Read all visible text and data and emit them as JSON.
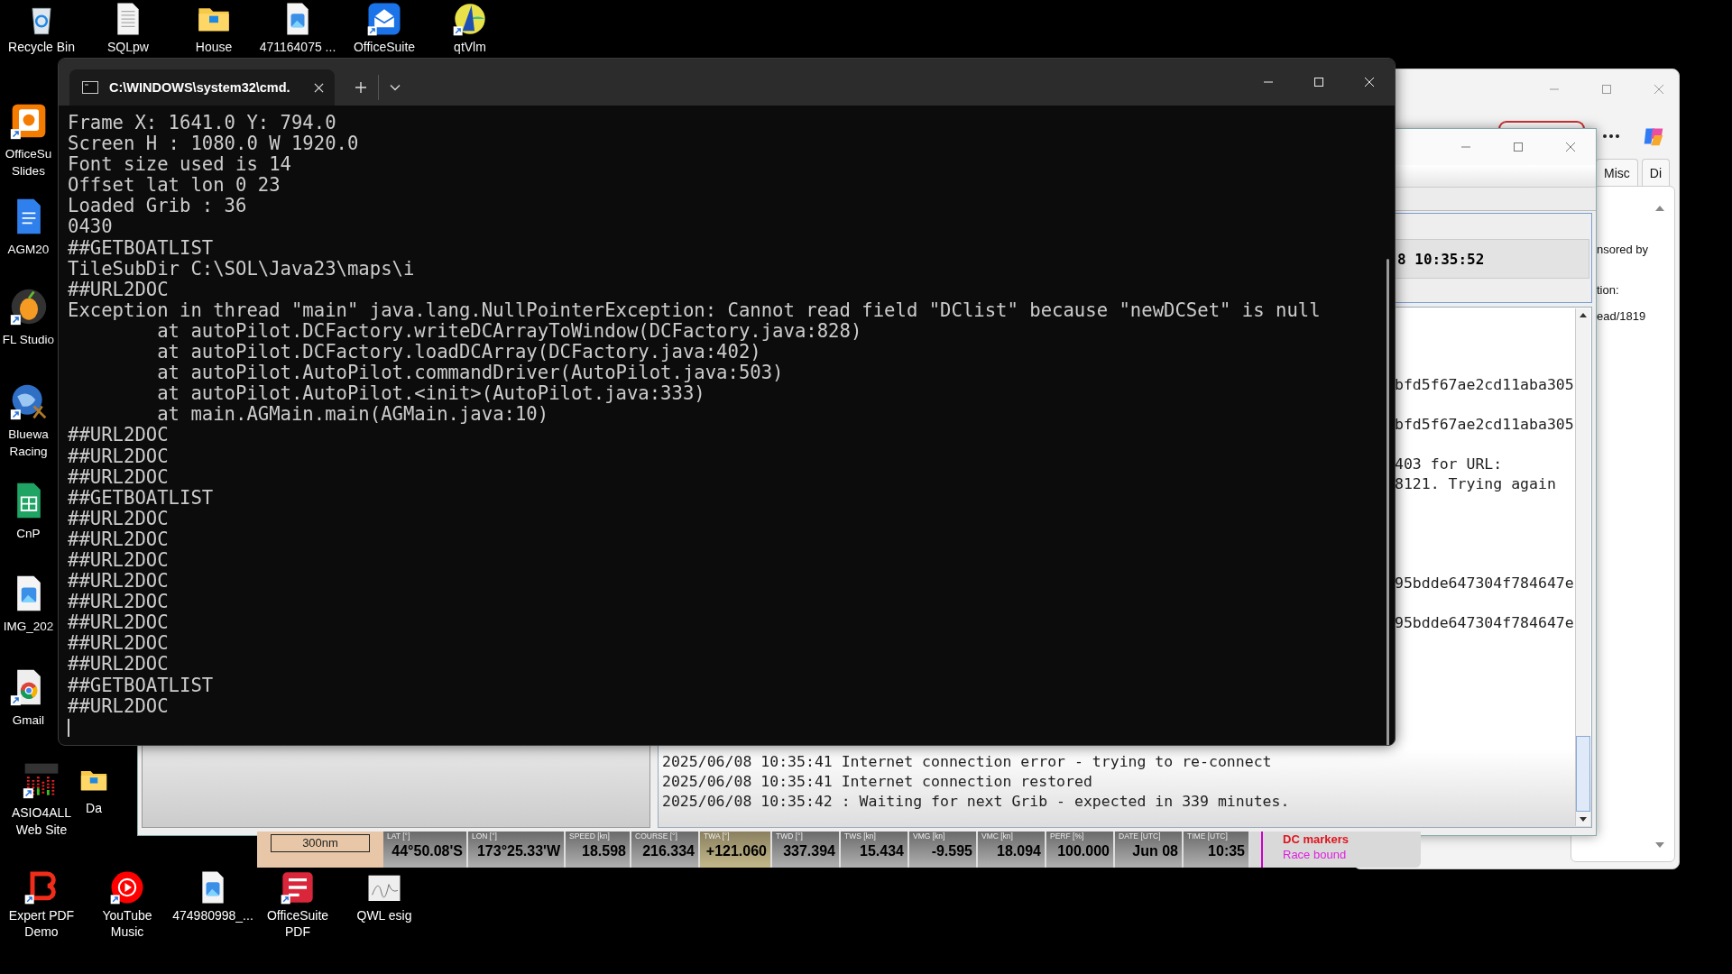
{
  "desktop_icons": [
    {
      "lines": [
        "Recycle Bin"
      ],
      "kind": "recycle",
      "shortcut": false
    },
    {
      "lines": [
        "SQLpw"
      ],
      "kind": "document",
      "shortcut": false
    },
    {
      "lines": [
        "House"
      ],
      "kind": "folder",
      "shortcut": false
    },
    {
      "lines": [
        "471164075 ..."
      ],
      "kind": "image",
      "shortcut": false
    },
    {
      "lines": [
        "OfficeSuite"
      ],
      "kind": "mail",
      "shortcut": true
    },
    {
      "lines": [
        "qtVlm"
      ],
      "kind": "sail",
      "shortcut": true
    },
    {
      "lines": [
        "OfficeSu",
        "Slides"
      ],
      "kind": "slides",
      "shortcut": true
    },
    {
      "lines": [
        "AGM20"
      ],
      "kind": "doc",
      "shortcut": false
    },
    {
      "lines": [
        "FL Studio"
      ],
      "kind": "fruit",
      "shortcut": true
    },
    {
      "lines": [
        "Bluewa",
        "Racing"
      ],
      "kind": "globe",
      "shortcut": true
    },
    {
      "lines": [
        "CnP"
      ],
      "kind": "sheet",
      "shortcut": false
    },
    {
      "lines": [
        "IMG_202"
      ],
      "kind": "image",
      "shortcut": false
    },
    {
      "lines": [
        "Gmail"
      ],
      "kind": "browser",
      "shortcut": true
    },
    {
      "lines": [
        "ASIO4ALL",
        "Web Site"
      ],
      "kind": "meter",
      "shortcut": true
    },
    {
      "lines": [
        "Da"
      ],
      "kind": "folder",
      "shortcut": false
    },
    {
      "lines": [
        "Expert PDF",
        "Demo"
      ],
      "kind": "pdf",
      "shortcut": true
    },
    {
      "lines": [
        "YouTube",
        "Music"
      ],
      "kind": "play",
      "shortcut": true
    },
    {
      "lines": [
        "474980998_..."
      ],
      "kind": "image",
      "shortcut": false
    },
    {
      "lines": [
        "OfficeSuite",
        "PDF"
      ],
      "kind": "pdfred",
      "shortcut": true
    },
    {
      "lines": [
        "QWL esig"
      ],
      "kind": "signature",
      "shortcut": false
    }
  ],
  "browser": {
    "tabs": [
      {
        "label": "Misc",
        "selected": false
      },
      {
        "label": "Di",
        "selected": false
      }
    ],
    "texts": [
      "nsored by",
      "tion:",
      "ead/1819"
    ]
  },
  "app": {
    "clock": "8 10:35:52",
    "log_fragments": [
      "bfd5f67ae2cd11aba305",
      "bfd5f67ae2cd11aba305",
      "403 for URL:",
      "8121. Trying again",
      "95bdde647304f784647e",
      "95bdde647304f784647e"
    ],
    "log_lines": [
      "2025/06/08 10:35:41 Internet connection error - trying to re-connect",
      "2025/06/08 10:35:41 Internet connection restored",
      "2025/06/08 10:35:42 : Waiting for next Grib - expected in 339 minutes."
    ]
  },
  "status_bar": {
    "range": "300nm",
    "cells": [
      {
        "label": "LAT [°]",
        "value": "44°50.08'S",
        "highlighted": false
      },
      {
        "label": "LON [°]",
        "value": "173°25.33'W",
        "highlighted": false
      },
      {
        "label": "SPEED [kn]",
        "value": "18.598",
        "highlighted": false
      },
      {
        "label": "COURSE [°]",
        "value": "216.334",
        "highlighted": false
      },
      {
        "label": "TWA [°]",
        "value": "+121.060",
        "highlighted": true
      },
      {
        "label": "TWD [°]",
        "value": "337.394",
        "highlighted": false
      },
      {
        "label": "TWS [kn]",
        "value": "15.434",
        "highlighted": false
      },
      {
        "label": "VMG [kn]",
        "value": "-9.595",
        "highlighted": false
      },
      {
        "label": "VMC [kn]",
        "value": "18.094",
        "highlighted": false
      },
      {
        "label": "PERF [%]",
        "value": "100.000",
        "highlighted": false
      },
      {
        "label": "DATE [UTC]",
        "value": "Jun 08",
        "highlighted": false
      },
      {
        "label": "TIME [UTC]",
        "value": "10:35",
        "highlighted": false
      }
    ],
    "markers": "DC markers",
    "boundary": "Race bound"
  },
  "console": {
    "tab": {
      "title": "C:\\WINDOWS\\system32\\cmd.",
      "selected": true
    },
    "lines": [
      "Frame X: 1641.0 Y: 794.0",
      "Screen H : 1080.0 W 1920.0",
      "Font size used is 14",
      "Offset lat lon 0 23",
      "Loaded Grib : 36",
      "0430",
      "##GETBOATLIST",
      "TileSubDir C:\\SOL\\Java23\\maps\\i",
      "##URL2DOC",
      "Exception in thread \"main\" java.lang.NullPointerException: Cannot read field \"DClist\" because \"newDCSet\" is null",
      "        at autoPilot.DCFactory.writeDCArrayToWindow(DCFactory.java:828)",
      "        at autoPilot.DCFactory.loadDCArray(DCFactory.java:402)",
      "        at autoPilot.AutoPilot.commandDriver(AutoPilot.java:503)",
      "        at autoPilot.AutoPilot.<init>(AutoPilot.java:333)",
      "        at main.AGMain.main(AGMain.java:10)",
      "##URL2DOC",
      "##URL2DOC",
      "##URL2DOC",
      "##GETBOATLIST",
      "##URL2DOC",
      "##URL2DOC",
      "##URL2DOC",
      "##URL2DOC",
      "##URL2DOC",
      "##URL2DOC",
      "##URL2DOC",
      "##URL2DOC",
      "##GETBOATLIST",
      "##URL2DOC"
    ]
  }
}
